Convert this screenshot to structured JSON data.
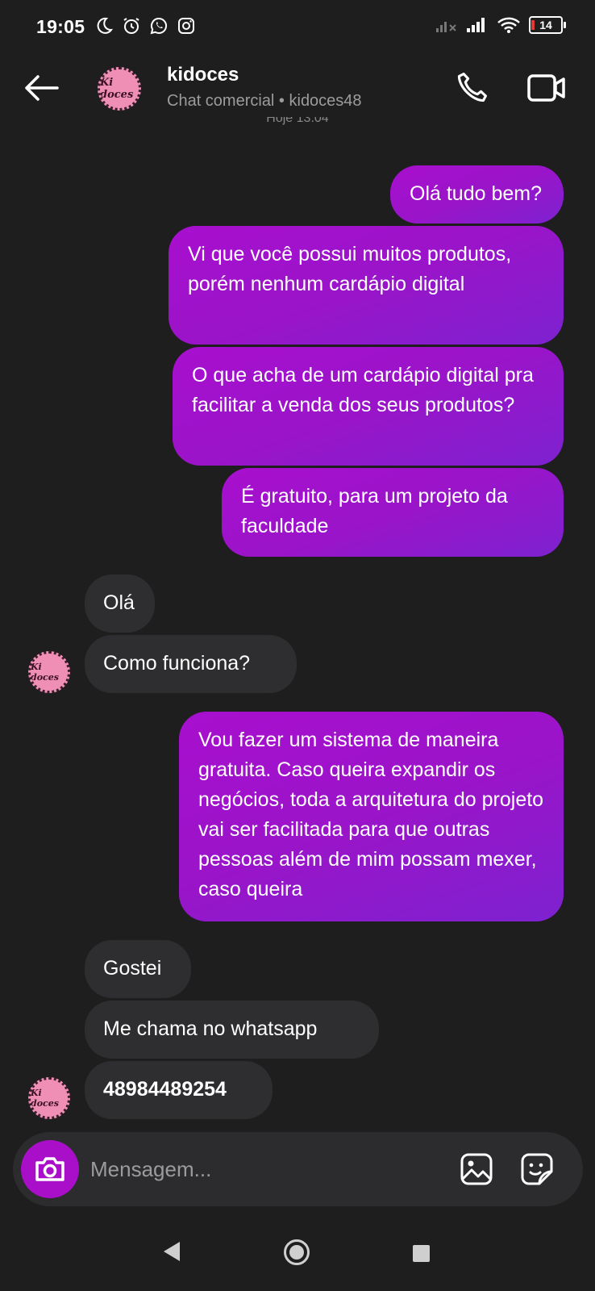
{
  "status_bar": {
    "time": "19:05",
    "battery": "14",
    "icons_left": [
      "moon-icon",
      "alarm-icon",
      "whatsapp-icon",
      "instagram-icon"
    ],
    "icons_right": [
      "signal-off-icon",
      "signal-icon",
      "wifi-icon",
      "battery-icon"
    ]
  },
  "header": {
    "name": "kidoces",
    "subtitle": "Chat comercial • kidoces48",
    "avatar_text": "Ki doces",
    "date_label": "Hoje 13:04"
  },
  "messages": [
    {
      "dir": "out",
      "text": "Olá tudo bem?"
    },
    {
      "dir": "out",
      "text": "Vi que você possui muitos produtos, porém nenhum cardápio digital"
    },
    {
      "dir": "out",
      "text": "O que acha de um cardápio digital pra facilitar a venda dos seus produtos?"
    },
    {
      "dir": "out",
      "text": "É gratuito, para um projeto da faculdade"
    },
    {
      "dir": "in",
      "text": "Olá"
    },
    {
      "dir": "in",
      "text": "Como funciona?"
    },
    {
      "dir": "out",
      "text": "Vou fazer um sistema de maneira gratuita. Caso queira expandir os negócios, toda a arquitetura do projeto vai ser facilitada para que outras pessoas além de mim possam mexer, caso queira"
    },
    {
      "dir": "in",
      "text": "Gostei"
    },
    {
      "dir": "in",
      "text": "Me chama no whatsapp"
    },
    {
      "dir": "in",
      "text": "48984489254"
    }
  ],
  "composer": {
    "placeholder": "Mensagem..."
  },
  "colors": {
    "background": "#1e1e1f",
    "outgoing_bubble": "#a10fcd",
    "incoming_bubble": "#2e2e30",
    "camera_button": "#a90fc9"
  }
}
